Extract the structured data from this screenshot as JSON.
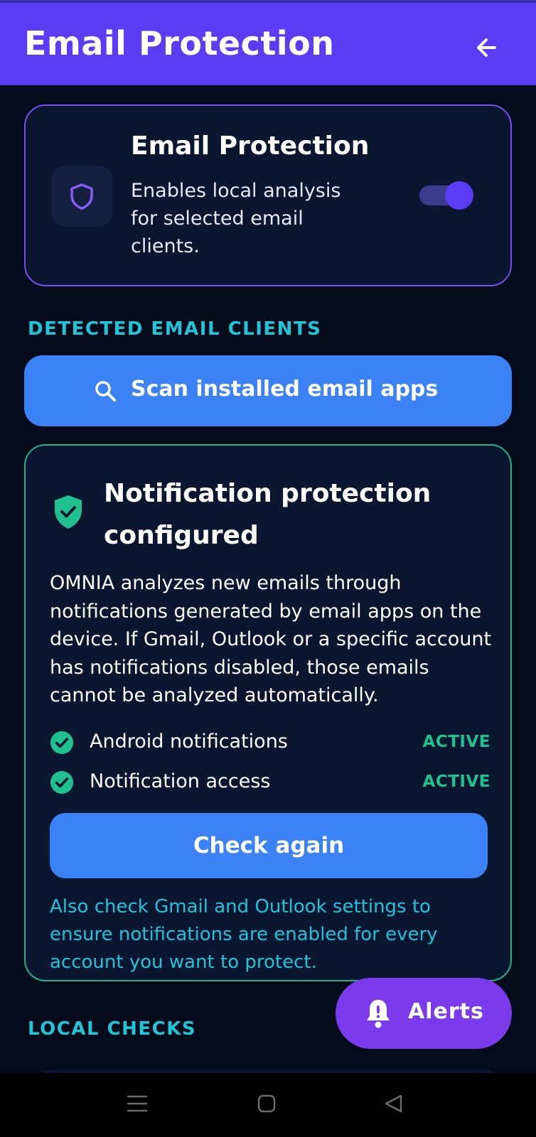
{
  "header": {
    "title": "Email Protection",
    "back_icon": "arrow-left-icon"
  },
  "protection_card": {
    "icon": "shield-icon",
    "title": "Email Protection",
    "description": "Enables local analysis for selected email clients.",
    "toggle_on": true
  },
  "detected_section": {
    "label": "DETECTED EMAIL CLIENTS"
  },
  "scan_button": {
    "icon": "search-icon",
    "label": "Scan installed email apps"
  },
  "notification_card": {
    "icon": "shield-check-icon",
    "title": "Notification protection configured",
    "body": "OMNIA analyzes new emails through notifications generated by email apps on the device. If Gmail, Outlook or a specific account has notifications disabled, those emails cannot be analyzed automatically.",
    "statuses": [
      {
        "name": "Android notifications",
        "state": "ACTIVE"
      },
      {
        "name": "Notification access",
        "state": "ACTIVE"
      }
    ],
    "check_button": "Check again",
    "note": "Also check Gmail and Outlook settings to ensure notifications are enabled for every account you want to protect."
  },
  "local_section": {
    "label": "LOCAL CHECKS"
  },
  "fab": {
    "icon": "bell-alert-icon",
    "label": "Alerts"
  },
  "colors": {
    "background": "#050b1a",
    "header": "#5b3cf5",
    "accent_blue": "#3b82f6",
    "success": "#1fc28e",
    "cyan": "#20c6d8",
    "fab": "#7c3aed"
  }
}
